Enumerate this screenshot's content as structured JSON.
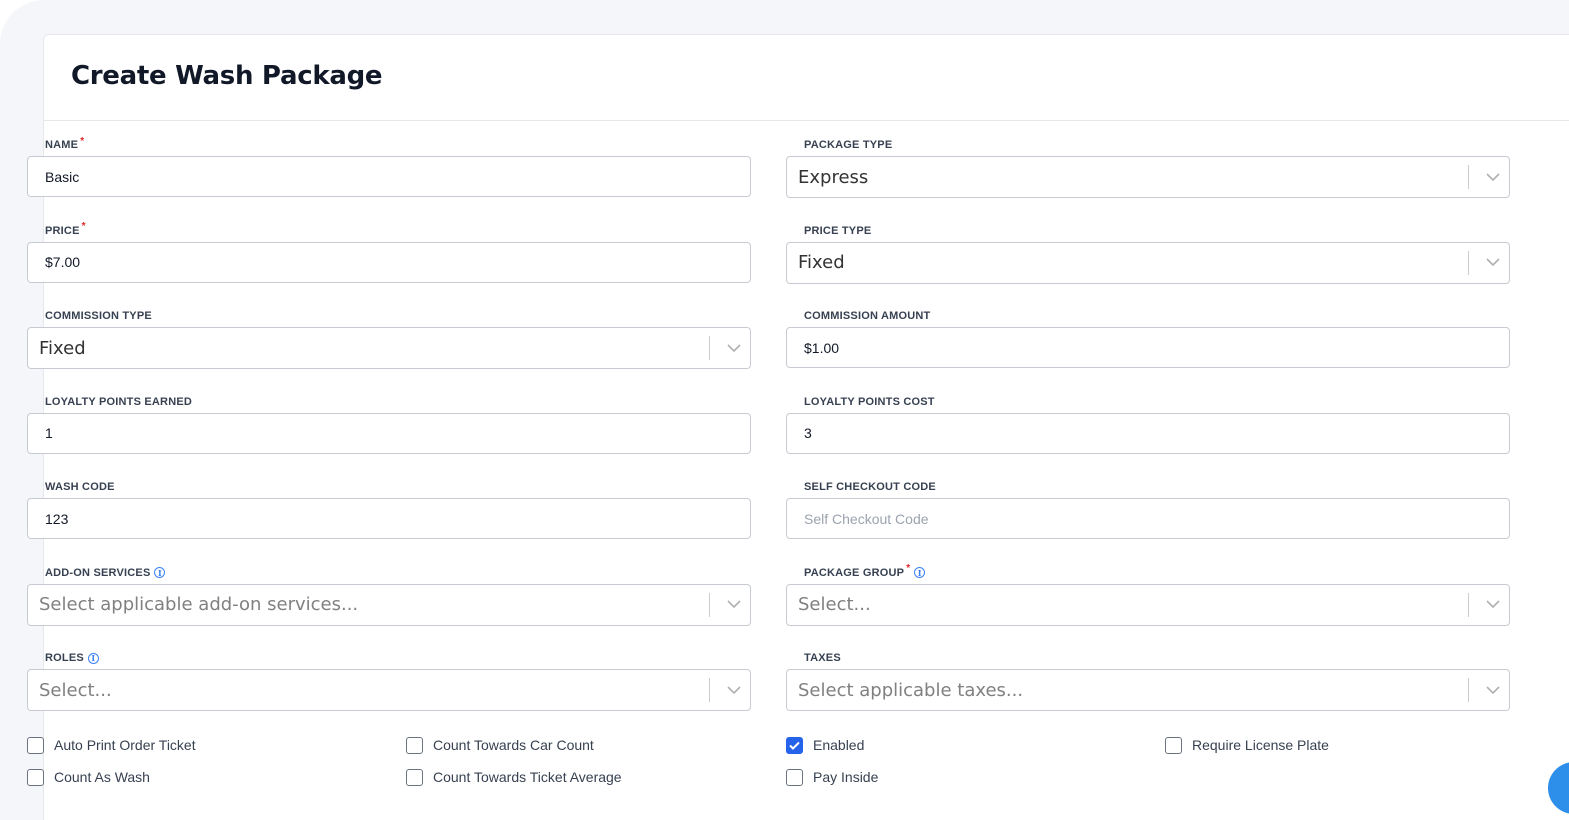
{
  "page": {
    "title": "Create Wash Package"
  },
  "fields": {
    "name": {
      "label": "NAME",
      "value": "Basic",
      "required": true
    },
    "package_type": {
      "label": "PACKAGE TYPE",
      "value": "Express"
    },
    "price": {
      "label": "PRICE",
      "value": "$7.00",
      "required": true
    },
    "price_type": {
      "label": "PRICE TYPE",
      "value": "Fixed"
    },
    "commission_type": {
      "label": "COMMISSION TYPE",
      "value": "Fixed"
    },
    "commission_amount": {
      "label": "COMMISSION AMOUNT",
      "value": "$1.00"
    },
    "loyalty_points_earned": {
      "label": "LOYALTY POINTS EARNED",
      "value": "1"
    },
    "loyalty_points_cost": {
      "label": "LOYALTY POINTS COST",
      "value": "3"
    },
    "wash_code": {
      "label": "WASH CODE",
      "value": "123"
    },
    "self_checkout_code": {
      "label": "SELF CHECKOUT CODE",
      "value": "",
      "placeholder": "Self Checkout Code"
    },
    "add_on_services": {
      "label": "ADD-ON SERVICES",
      "placeholder": "Select applicable add-on services..."
    },
    "package_group": {
      "label": "PACKAGE GROUP",
      "placeholder": "Select...",
      "required": true
    },
    "roles": {
      "label": "ROLES",
      "placeholder": "Select..."
    },
    "taxes": {
      "label": "TAXES",
      "placeholder": "Select applicable taxes..."
    }
  },
  "checkboxes": {
    "auto_print_order_ticket": {
      "label": "Auto Print Order Ticket",
      "checked": false
    },
    "count_towards_car_count": {
      "label": "Count Towards Car Count",
      "checked": false
    },
    "enabled": {
      "label": "Enabled",
      "checked": true
    },
    "require_license_plate": {
      "label": "Require License Plate",
      "checked": false
    },
    "count_as_wash": {
      "label": "Count As Wash",
      "checked": false
    },
    "count_towards_ticket_average": {
      "label": "Count Towards Ticket Average",
      "checked": false
    },
    "pay_inside": {
      "label": "Pay Inside",
      "checked": false
    }
  },
  "icons": {
    "chevron": "chevron-down-icon",
    "info": "info-icon",
    "check": "checkmark-icon"
  },
  "colors": {
    "accent": "#2563eb",
    "required": "#dc2626",
    "info": "#3b82f6",
    "chat": "#2d8fea"
  }
}
